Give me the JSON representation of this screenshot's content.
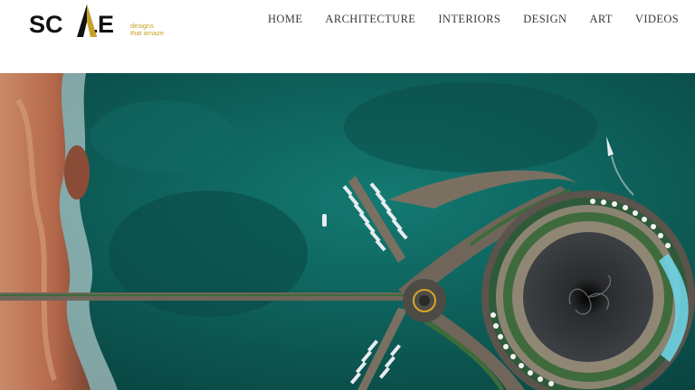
{
  "brand": {
    "logo_text_left": "SC",
    "logo_text_right": "LE",
    "logo_text_full": "SCALE",
    "tagline_line1": "designs",
    "tagline_line2": "that amaze",
    "accent_color": "#c9a227"
  },
  "nav": {
    "items": [
      {
        "label": "HOME"
      },
      {
        "label": "ARCHITECTURE"
      },
      {
        "label": "INTERIORS"
      },
      {
        "label": "DESIGN"
      },
      {
        "label": "ART"
      },
      {
        "label": "VIDEOS"
      }
    ]
  },
  "hero": {
    "image_subject": "aerial-view-floating-hotel",
    "sea_color": "#0d5a55",
    "shore_color": "#b4684a"
  }
}
